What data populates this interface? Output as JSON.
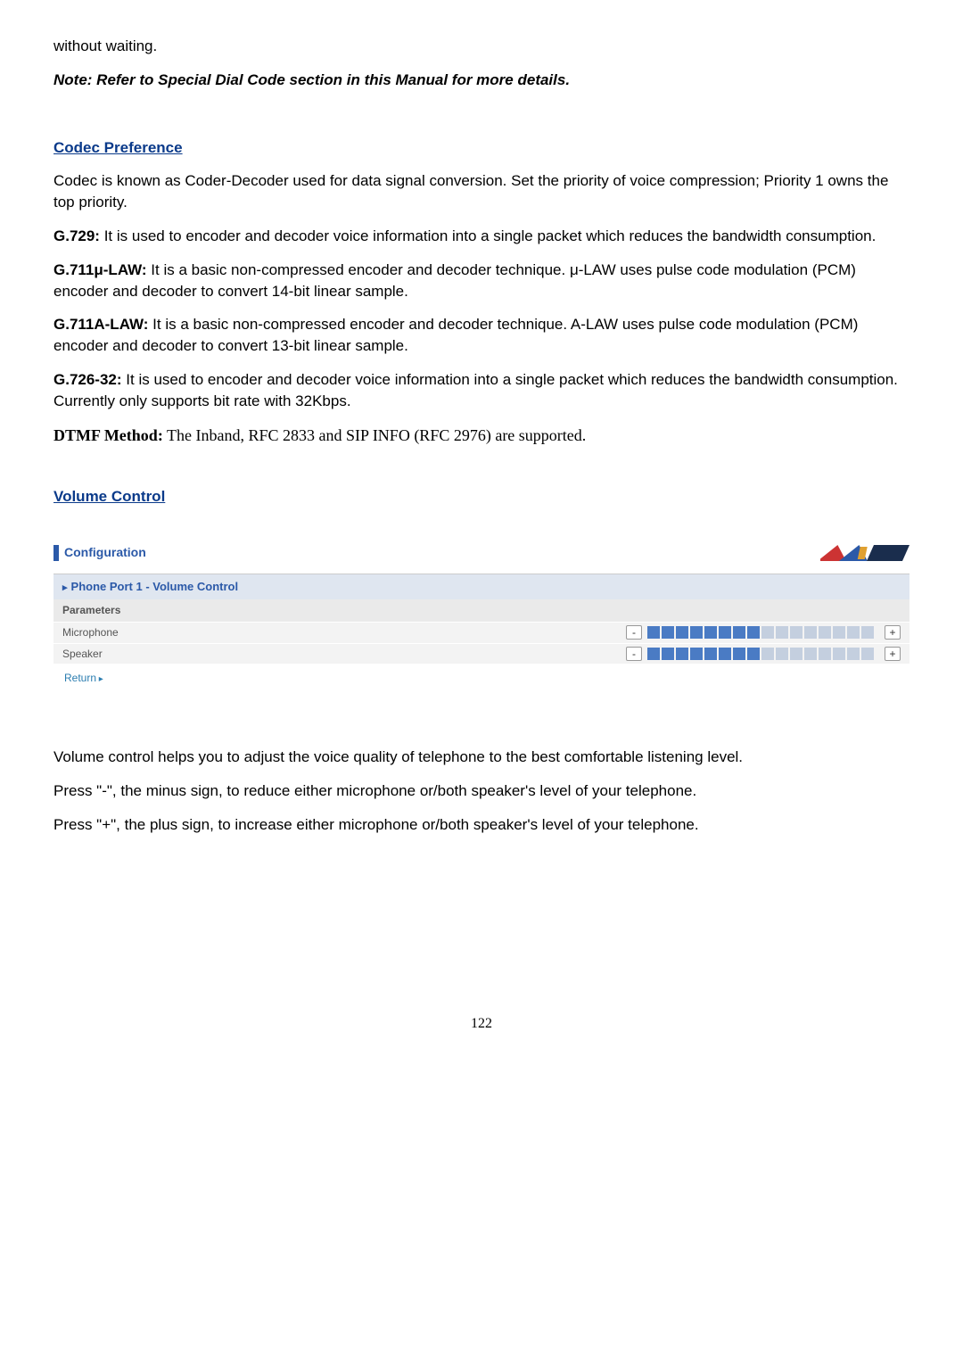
{
  "intro": "without waiting.",
  "note": "Note: Refer to Special Dial Code section in this Manual for more details.",
  "codec": {
    "heading": "Codec Preference",
    "p1": "Codec is known as Coder-Decoder used for data signal conversion.  Set the priority of voice compression; Priority 1 owns the top priority.",
    "g729_label": "G.729:",
    "g729_text": " It is used to encoder and decoder voice information into a single packet which reduces the bandwidth consumption.",
    "g711u_label": "G.711μ-LAW:",
    "g711u_text": "  It is a basic non-compressed encoder and decoder technique. μ-LAW uses pulse code modulation (PCM) encoder and decoder to convert 14-bit linear sample.",
    "g711a_label": "G.711A-LAW:",
    "g711a_text": "  It is a basic non-compressed encoder and decoder technique. A-LAW uses pulse code modulation (PCM) encoder and decoder to convert 13-bit linear sample.",
    "g726_label": "G.726-32:",
    "g726_text": "  It is used to encoder and decoder voice information into a single packet which reduces the bandwidth consumption. Currently only supports bit rate with 32Kbps.",
    "dtmf_label": "DTMF Method:",
    "dtmf_text": " The Inband, RFC 2833 and SIP INFO (RFC 2976) are supported."
  },
  "volume": {
    "heading": "Volume Control",
    "config_title": "Configuration",
    "panel_title": "Phone Port 1 - Volume Control",
    "params_header": "Parameters",
    "mic_label": "Microphone",
    "speaker_label": "Speaker",
    "minus": "-",
    "plus": "+",
    "return": "Return",
    "mic_level": 8,
    "speaker_level": 8,
    "max_level": 16,
    "p1": "Volume control helps you to adjust the voice quality of telephone to the best comfortable listening level.",
    "p2": "Press \"-\", the minus sign, to reduce either microphone or/both speaker's level of your telephone.",
    "p3": "Press \"+\", the plus sign, to increase either microphone or/both speaker's level of your telephone."
  },
  "page_number": "122"
}
